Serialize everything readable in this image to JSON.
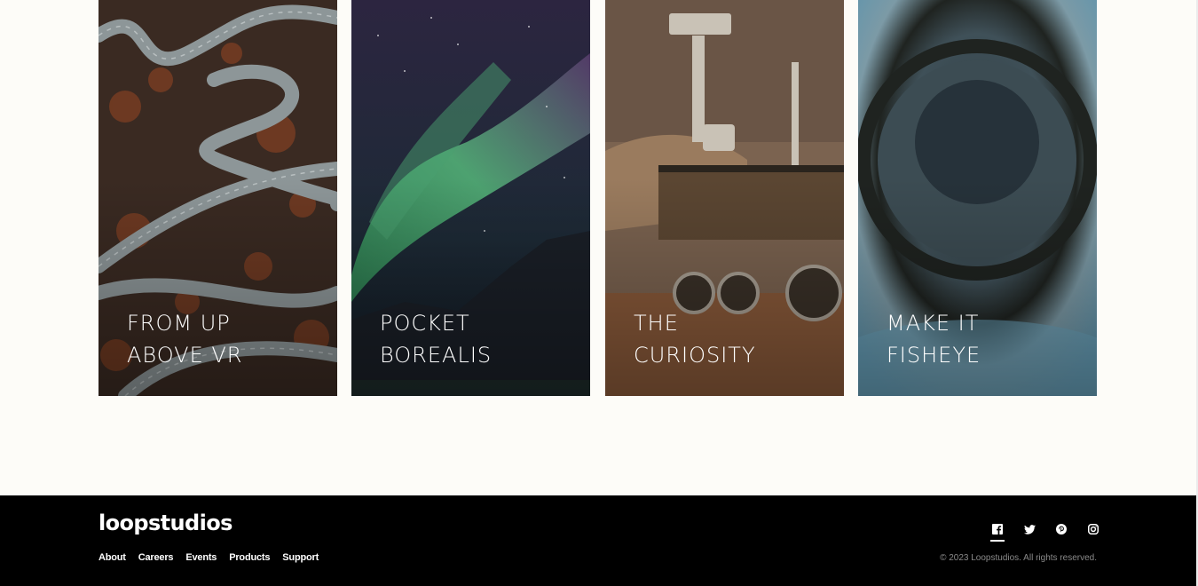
{
  "creations": [
    {
      "id": "from-up-above-vr",
      "title_lines": [
        "From up",
        "above VR"
      ]
    },
    {
      "id": "pocket-borealis",
      "title_lines": [
        "Pocket",
        "borealis"
      ]
    },
    {
      "id": "the-curiosity",
      "title_lines": [
        "The",
        "curiosity"
      ]
    },
    {
      "id": "make-it-fisheye",
      "title_lines": [
        "Make it",
        "fisheye"
      ]
    }
  ],
  "footer": {
    "logo": "loopstudios",
    "nav": [
      {
        "label": "About"
      },
      {
        "label": "Careers"
      },
      {
        "label": "Events"
      },
      {
        "label": "Products"
      },
      {
        "label": "Support"
      }
    ],
    "socials": [
      {
        "icon": "facebook-icon",
        "active": true
      },
      {
        "icon": "twitter-icon",
        "active": false
      },
      {
        "icon": "pinterest-icon",
        "active": false
      },
      {
        "icon": "instagram-icon",
        "active": false
      }
    ],
    "copyright": "© 2023 Loopstudios. All rights reserved."
  },
  "colors": {
    "page_bg": "#fdfcf8",
    "footer_bg": "#000000",
    "footer_text": "#ffffff",
    "copyright_text": "#8a8a8a"
  }
}
